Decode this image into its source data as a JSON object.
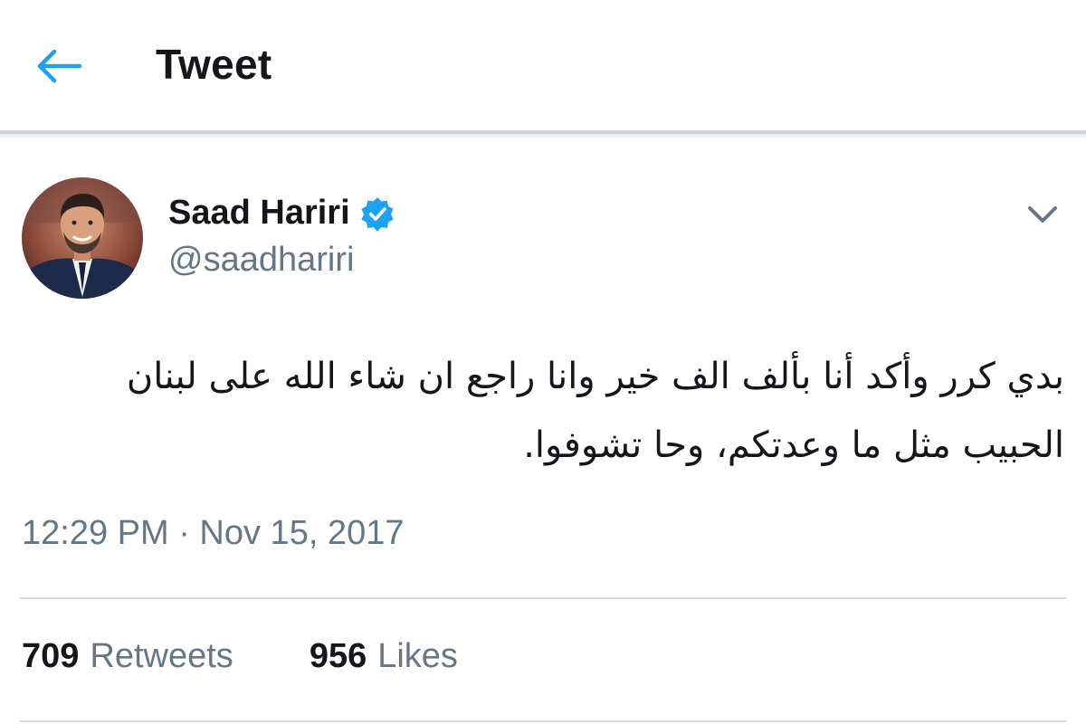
{
  "header": {
    "back_icon": "arrow-left-icon",
    "title": "Tweet",
    "accent_color": "#1da1f2"
  },
  "tweet": {
    "author": {
      "name": "Saad Hariri",
      "handle": "@saadhariri",
      "verified": true,
      "verified_icon": "verified-badge-icon"
    },
    "menu_icon": "chevron-down-icon",
    "text": "بدي كرر  وأكد أنا بألف الف خير وانا راجع ان شاء الله على لبنان الحبيب مثل ما وعدتكم، وحا تشوفوا.",
    "timestamp": "12:29 PM · Nov 15, 2017",
    "stats": {
      "retweets_count": "709",
      "retweets_label": "Retweets",
      "likes_count": "956",
      "likes_label": "Likes"
    }
  },
  "colors": {
    "primary_text": "#14171a",
    "secondary_text": "#657786",
    "divider": "#d4dbe1"
  }
}
